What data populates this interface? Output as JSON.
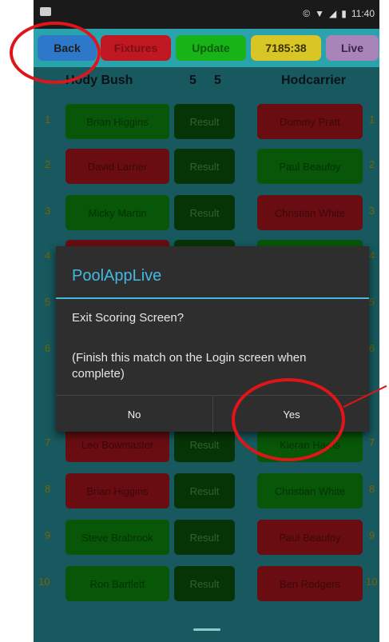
{
  "status_bar": {
    "time": "11:40"
  },
  "toolbar": {
    "back": "Back",
    "fixtures": "Fixtures",
    "update": "Update",
    "timer": "7185:38",
    "live": "Live"
  },
  "match": {
    "home_team": "Hody Bush",
    "home_score": "5",
    "away_score": "5",
    "away_team": "Hodcarrier",
    "rows": [
      {
        "num": "1",
        "home": "Brian Higgins",
        "result": "Result",
        "away": "Dommy Pratt",
        "home_color": "green",
        "away_color": "red"
      },
      {
        "num": "2",
        "home": "David Larner",
        "result": "Result",
        "away": "Paul Beaufoy",
        "home_color": "red",
        "away_color": "green"
      },
      {
        "num": "3",
        "home": "Micky Martin",
        "result": "Result",
        "away": "Christian White",
        "home_color": "green",
        "away_color": "red"
      },
      {
        "num": "4",
        "home": "",
        "result": "",
        "away": "",
        "home_color": "red",
        "away_color": "green"
      },
      {
        "num": "5",
        "home": "",
        "result": "",
        "away": "",
        "home_color": "green",
        "away_color": "red"
      },
      {
        "num": "6",
        "home": "",
        "result": "",
        "away": "",
        "home_color": "red",
        "away_color": "green"
      },
      {
        "num": "7",
        "home": "Leo Bowmaster",
        "result": "Result",
        "away": "Kieran Harris",
        "home_color": "red",
        "away_color": "green"
      },
      {
        "num": "8",
        "home": "Brian Higgins",
        "result": "Result",
        "away": "Christian White",
        "home_color": "red",
        "away_color": "green"
      },
      {
        "num": "9",
        "home": "Steve Brabrook",
        "result": "Result",
        "away": "Paul Beaufoy",
        "home_color": "green",
        "away_color": "red"
      },
      {
        "num": "10",
        "home": "Ron Bartlett",
        "result": "Result",
        "away": "Ben Rodgers",
        "home_color": "green",
        "away_color": "red"
      }
    ]
  },
  "dialog": {
    "title": "PoolAppLive",
    "message": "Exit Scoring Screen?",
    "note": "(Finish this match on the Login screen when complete)",
    "no": "No",
    "yes": "Yes"
  },
  "colors": {
    "teal": "#2aa3ac",
    "win_green": "#0f9d0f",
    "loss_red": "#c01822",
    "result_green": "#0d5f0d",
    "annotation_red": "#e0151a"
  }
}
